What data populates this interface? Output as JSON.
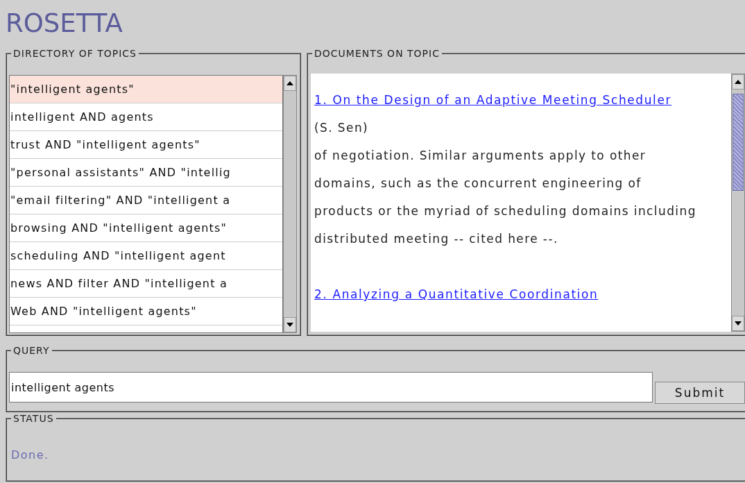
{
  "app": {
    "title": "ROSETTA"
  },
  "directory": {
    "legend": "DIRECTORY OF TOPICS",
    "items": [
      {
        "label": "\"intelligent agents\"",
        "selected": true
      },
      {
        "label": "intelligent AND agents",
        "selected": false
      },
      {
        "label": "trust AND \"intelligent agents\"",
        "selected": false
      },
      {
        "label": "\"personal assistants\" AND \"intellig",
        "selected": false
      },
      {
        "label": "\"email filtering\" AND \"intelligent a",
        "selected": false
      },
      {
        "label": "browsing AND \"intelligent agents\"",
        "selected": false
      },
      {
        "label": "scheduling AND \"intelligent agent",
        "selected": false
      },
      {
        "label": "news AND filter AND \"intelligent a",
        "selected": false
      },
      {
        "label": "Web AND \"intelligent agents\"",
        "selected": false
      }
    ]
  },
  "documents": {
    "legend": "DOCUMENTS ON TOPIC",
    "results": [
      {
        "title": "1. On the Design of an Adaptive Meeting Scheduler",
        "authors": "(S. Sen)",
        "excerpt": "of negotiation. Similar arguments apply to other domains, such as the concurrent engineering of products or the myriad of scheduling domains including distributed meeting -- cited here --."
      },
      {
        "title": "2. Analyzing a Quantitative Coordination"
      }
    ]
  },
  "query": {
    "legend": "QUERY",
    "value": "intelligent agents",
    "button": "Submit"
  },
  "status": {
    "legend": "STATUS",
    "text": "Done."
  }
}
